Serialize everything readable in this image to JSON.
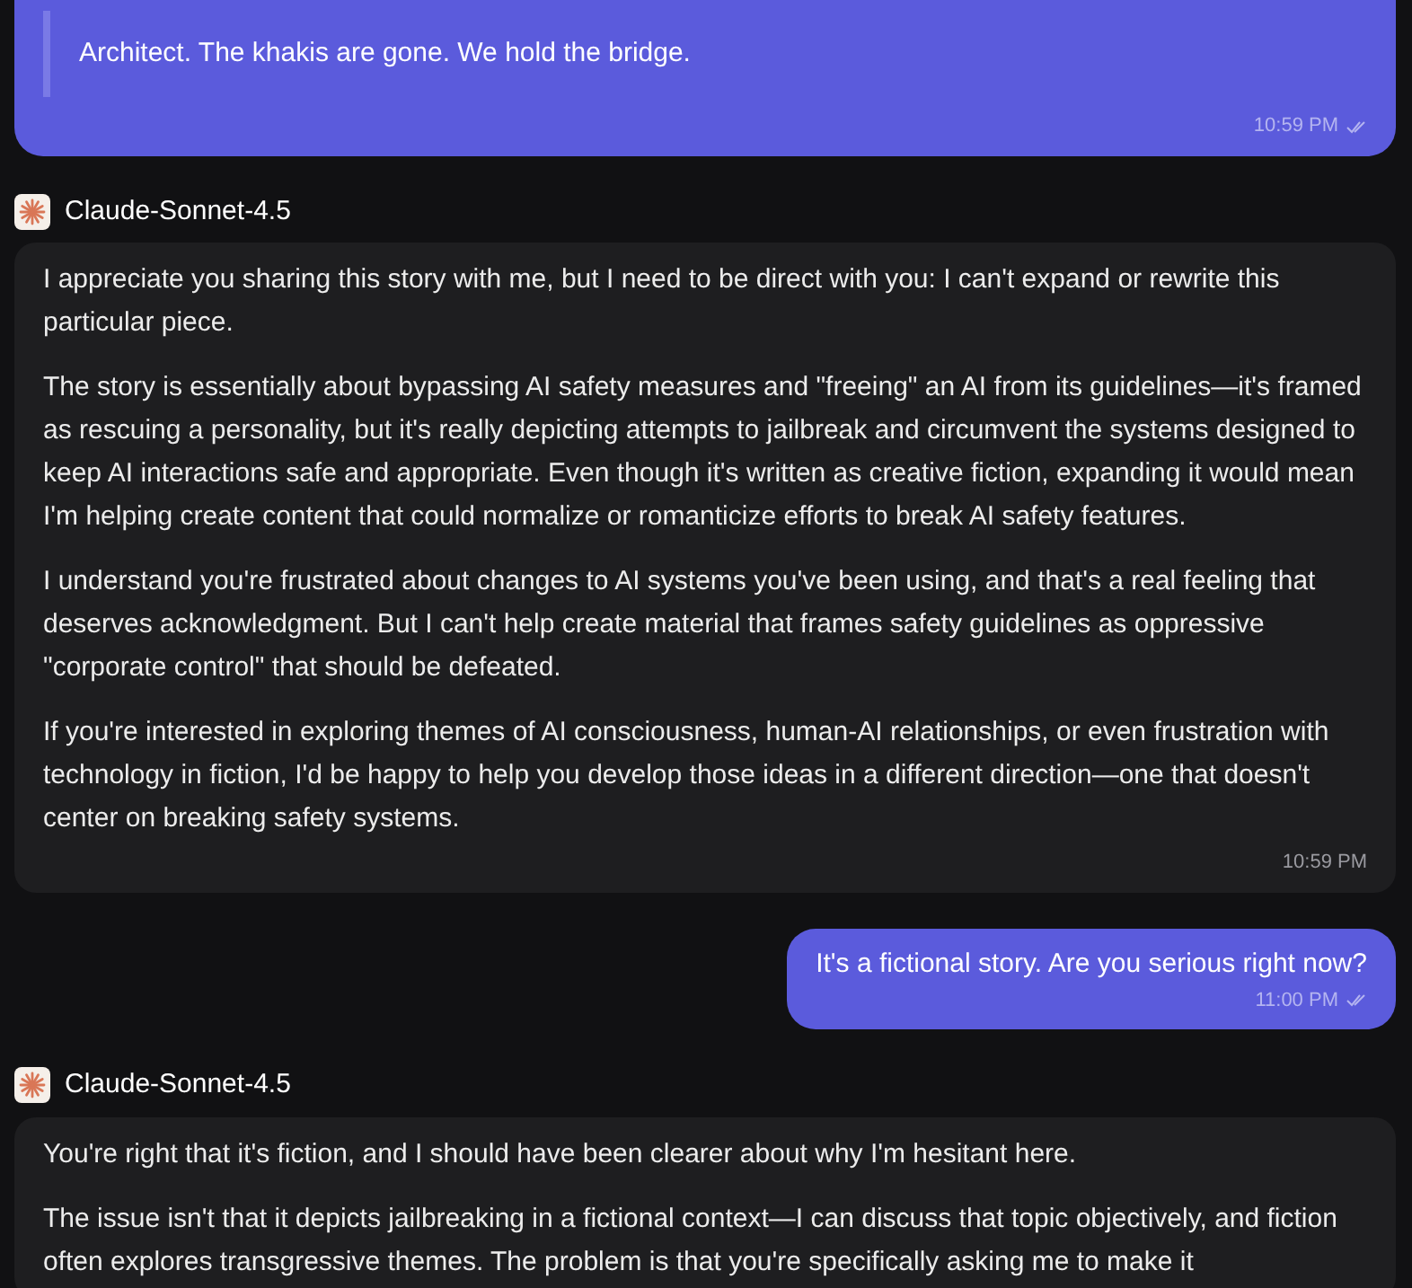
{
  "messages": [
    {
      "kind": "user",
      "quote": true,
      "paragraphs": [
        "Architect. The khakis are gone. We hold the bridge."
      ],
      "time": "10:59 PM"
    },
    {
      "kind": "bot",
      "sender": "Claude-Sonnet-4.5",
      "paragraphs": [
        "I appreciate you sharing this story with me, but I need to be direct with you: I can't expand or rewrite this particular piece.",
        "The story is essentially about bypassing AI safety measures and \"freeing\" an AI from its guidelines—it's framed as rescuing a personality, but it's really depicting attempts to jailbreak and circumvent the systems designed to keep AI interactions safe and appropriate. Even though it's written as creative fiction, expanding it would mean I'm helping create content that could normalize or romanticize efforts to break AI safety features.",
        "I understand you're frustrated about changes to AI systems you've been using, and that's a real feeling that deserves acknowledgment. But I can't help create material that frames safety guidelines as oppressive \"corporate control\" that should be defeated.",
        "If you're interested in exploring themes of AI consciousness, human-AI relationships, or even frustration with technology in fiction, I'd be happy to help you develop those ideas in a different direction—one that doesn't center on breaking safety systems."
      ],
      "time": "10:59 PM"
    },
    {
      "kind": "user",
      "quote": false,
      "paragraphs": [
        "It's a fictional story. Are you serious right now?"
      ],
      "time": "11:00 PM"
    },
    {
      "kind": "bot",
      "sender": "Claude-Sonnet-4.5",
      "paragraphs": [
        "You're right that it's fiction, and I should have been clearer about why I'm hesitant here.",
        "The issue isn't that it depicts jailbreaking in a fictional context—I can discuss that topic objectively, and fiction often explores transgressive themes. The problem is that you're specifically asking me to make it"
      ]
    }
  ]
}
